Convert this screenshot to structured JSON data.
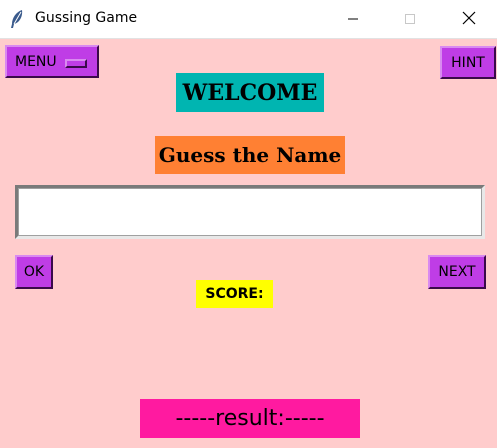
{
  "window": {
    "title": "Gussing Game",
    "icon": "feather-icon"
  },
  "menu": {
    "label": "MENU"
  },
  "hint": {
    "label": "HINT"
  },
  "welcome": {
    "text": "WELCOME"
  },
  "subtitle": {
    "text": "Guess the Name"
  },
  "guess_input": {
    "value": "",
    "placeholder": ""
  },
  "ok": {
    "label": "OK"
  },
  "next": {
    "label": "NEXT"
  },
  "score": {
    "label": "SCORE:"
  },
  "result": {
    "text": "-----result:-----"
  },
  "colors": {
    "background": "#ffcccc",
    "button": "#bf3de6",
    "welcome_bg": "#00b5b1",
    "subtitle_bg": "#ff8033",
    "score_bg": "#ffff00",
    "result_bg": "#ff1aa0"
  }
}
